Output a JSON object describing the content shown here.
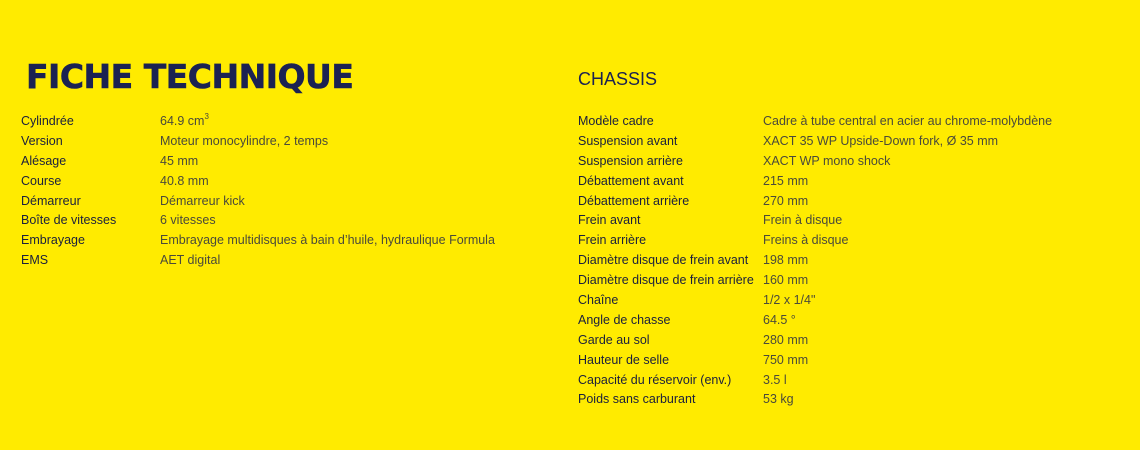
{
  "title": "FICHE TECHNIQUE",
  "engine": {
    "rows": [
      {
        "label": "Cylindrée",
        "value": "64.9 cm",
        "sup": "3"
      },
      {
        "label": "Version",
        "value": "Moteur monocylindre, 2 temps"
      },
      {
        "label": "Alésage",
        "value": "45 mm"
      },
      {
        "label": "Course",
        "value": "40.8 mm"
      },
      {
        "label": "Démarreur",
        "value": "Démarreur kick"
      },
      {
        "label": "Boîte de vitesses",
        "value": "6 vitesses"
      },
      {
        "label": "Embrayage",
        "value": "Embrayage multidisques à bain d’huile, hydraulique Formula"
      },
      {
        "label": "EMS",
        "value": "AET digital"
      }
    ]
  },
  "chassis": {
    "title": "CHASSIS",
    "rows": [
      {
        "label": "Modèle cadre",
        "value": "Cadre à tube central en acier au chrome-molybdène"
      },
      {
        "label": "Suspension avant",
        "value": "XACT 35 WP Upside-Down fork, Ø 35 mm"
      },
      {
        "label": "Suspension arrière",
        "value": "XACT WP mono shock"
      },
      {
        "label": "Débattement avant",
        "value": "215 mm"
      },
      {
        "label": "Débattement arrière",
        "value": "270 mm"
      },
      {
        "label": "Frein avant",
        "value": "Frein à disque"
      },
      {
        "label": "Frein arrière",
        "value": "Freins à disque"
      },
      {
        "label": "Diamètre disque de frein avant",
        "value": "198 mm"
      },
      {
        "label": "Diamètre disque de frein arrière",
        "value": "160 mm"
      },
      {
        "label": "Chaîne",
        "value": "1/2 x 1/4\""
      },
      {
        "label": "Angle de chasse",
        "value": "64.5 °"
      },
      {
        "label": "Garde au sol",
        "value": "280 mm"
      },
      {
        "label": "Hauteur de selle",
        "value": "750 mm"
      },
      {
        "label": "Capacité du réservoir (env.)",
        "value": "3.5 l"
      },
      {
        "label": "Poids sans carburant",
        "value": "53 kg"
      }
    ]
  },
  "colors": {
    "background": "#FFEB00",
    "title": "#1b2252",
    "text": "#1a1f3d"
  }
}
